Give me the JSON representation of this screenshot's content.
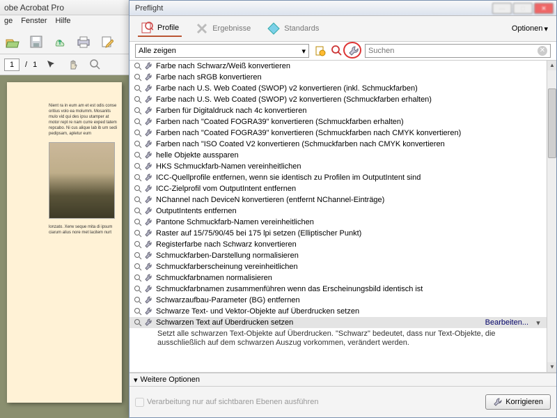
{
  "app": {
    "title": "obe Acrobat Pro",
    "menu": [
      "ge",
      "Fenster",
      "Hilfe"
    ],
    "page_current": "1",
    "page_total": "1",
    "doc_text_top": "Nient ra in eum am et est odis conse oritius volo ea molumm. Mosanits mulo vid qui des ipsu utamper at motor rept re nam curre exped tatem repcabo. Ni cus alique lab ib um sedi pedipsam, apletur eum",
    "doc_text_bot": "lonzato. Xerw seque mita di ipsum ciarum alius nore met lacitem nurt"
  },
  "dialog": {
    "title": "Preflight",
    "tabs": {
      "profile": "Profile",
      "ergebnisse": "Ergebnisse",
      "standards": "Standards"
    },
    "options": "Optionen",
    "filter_all": "Alle zeigen",
    "search_placeholder": "Suchen",
    "edit_label": "Bearbeiten...",
    "description": "Setzt alle schwarzen Text-Objekte auf Überdrucken. \"Schwarz\" bedeutet, dass nur Text-Objekte, die ausschließlich auf dem schwarzen Auszug vorkommen, verändert werden.",
    "expander": "Weitere Optionen",
    "footer_check": "Verarbeitung nur auf sichtbaren Ebenen ausführen",
    "korrigieren": "Korrigieren",
    "profiles": [
      "Farbe nach Schwarz/Weiß konvertieren",
      "Farbe nach sRGB konvertieren",
      "Farbe nach U.S. Web Coated (SWOP) v2 konvertieren (inkl. Schmuckfarben)",
      "Farbe nach U.S. Web Coated (SWOP) v2 konvertieren (Schmuckfarben erhalten)",
      "Farben für Digitaldruck nach 4c konvertieren",
      "Farben nach \"Coated FOGRA39\" konvertieren (Schmuckfarben erhalten)",
      "Farben nach \"Coated FOGRA39\" konvertieren (Schmuckfarben nach CMYK konvertieren)",
      "Farben nach \"ISO Coated V2 konvertieren (Schmuckfarben nach CMYK konvertieren",
      "helle Objekte aussparen",
      "HKS Schmuckfarb-Namen vereinheitlichen",
      "ICC-Quellprofile entfernen, wenn sie identisch zu Profilen im OutputIntent sind",
      "ICC-Zielprofil vom OutputIntent entfernen",
      "NChannel nach DeviceN konvertieren (entfernt NChannel-Einträge)",
      "OutputIntents entfernen",
      "Pantone Schmuckfarb-Namen vereinheitlichen",
      "Raster auf 15/75/90/45 bei 175 lpi setzen (Elliptischer Punkt)",
      "Registerfarbe nach Schwarz konvertieren",
      "Schmuckfarben-Darstellung normalisieren",
      "Schmuckfarberscheinung vereinheitlichen",
      "Schmuckfarbnamen normalisieren",
      "Schmuckfarbnamen zusammenführen wenn das Erscheinungsbild identisch ist",
      "Schwarzaufbau-Parameter (BG) entfernen",
      "Schwarze Text- und Vektor-Objekte auf Überdrucken setzen",
      "Schwarzen Text auf Überdrucken setzen"
    ],
    "selected_index": 23
  }
}
